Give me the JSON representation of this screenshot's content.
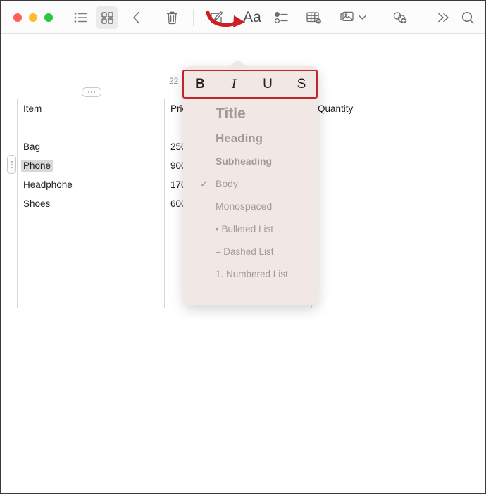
{
  "window": {
    "traffic_lights": [
      {
        "name": "close",
        "color": "#ff5f57"
      },
      {
        "name": "minimize",
        "color": "#febc2e"
      },
      {
        "name": "maximize",
        "color": "#28c840"
      }
    ]
  },
  "toolbar": {
    "buttons": [
      {
        "name": "list-view-button",
        "icon": "list-icon",
        "active": false
      },
      {
        "name": "grid-view-button",
        "icon": "grid-icon",
        "active": true
      },
      {
        "name": "back-button",
        "icon": "chevron-left-icon",
        "active": false
      },
      {
        "name": "delete-button",
        "icon": "trash-icon",
        "active": false
      },
      {
        "name": "markup-button",
        "icon": "markup-icon",
        "active": false
      },
      {
        "name": "format-button",
        "icon": "format-aa-icon",
        "active": false
      },
      {
        "name": "checklist-button",
        "icon": "checklist-icon",
        "active": false
      },
      {
        "name": "table-button",
        "icon": "table-icon",
        "active": false
      },
      {
        "name": "media-button",
        "icon": "media-icon",
        "active": false
      },
      {
        "name": "media-dropdown",
        "icon": "chevron-down-icon",
        "active": false
      },
      {
        "name": "link-button",
        "icon": "link-add-icon",
        "active": false
      },
      {
        "name": "more-button",
        "icon": "chevrons-right-icon",
        "active": false
      },
      {
        "name": "search-button",
        "icon": "search-icon",
        "active": false
      }
    ],
    "format_label": "Aa"
  },
  "annotation": {
    "arrow_color": "#c0272d",
    "highlight_color": "#c0272d"
  },
  "document": {
    "date": "22"
  },
  "table": {
    "headers": [
      "Item",
      "Price",
      "Quantity"
    ],
    "rows": [
      [
        "",
        "",
        ""
      ],
      [
        "Bag",
        "250",
        ""
      ],
      [
        "Phone",
        "900",
        ""
      ],
      [
        "Headphone",
        "170",
        ""
      ],
      [
        "Shoes",
        "600",
        ""
      ],
      [
        "",
        "",
        ""
      ],
      [
        "",
        "",
        ""
      ],
      [
        "",
        "",
        ""
      ],
      [
        "",
        "",
        ""
      ],
      [
        "",
        "",
        ""
      ]
    ],
    "selected_cell": "Phone"
  },
  "popover": {
    "style_buttons": [
      {
        "name": "bold-button",
        "label": "B"
      },
      {
        "name": "italic-button",
        "label": "I"
      },
      {
        "name": "underline-button",
        "label": "U"
      },
      {
        "name": "strikethrough-button",
        "label": "S"
      }
    ],
    "styles": [
      {
        "name": "style-title",
        "label": "Title",
        "checked": false
      },
      {
        "name": "style-heading",
        "label": "Heading",
        "checked": false
      },
      {
        "name": "style-subheading",
        "label": "Subheading",
        "checked": false
      },
      {
        "name": "style-body",
        "label": "Body",
        "checked": true
      },
      {
        "name": "style-monospaced",
        "label": "Monospaced",
        "checked": false
      },
      {
        "name": "style-bulleted-list",
        "label": "• Bulleted List",
        "checked": false
      },
      {
        "name": "style-dashed-list",
        "label": "– Dashed List",
        "checked": false
      },
      {
        "name": "style-numbered-list",
        "label": "1. Numbered List",
        "checked": false
      }
    ],
    "check_glyph": "✓",
    "background": "#f1e7e5"
  }
}
